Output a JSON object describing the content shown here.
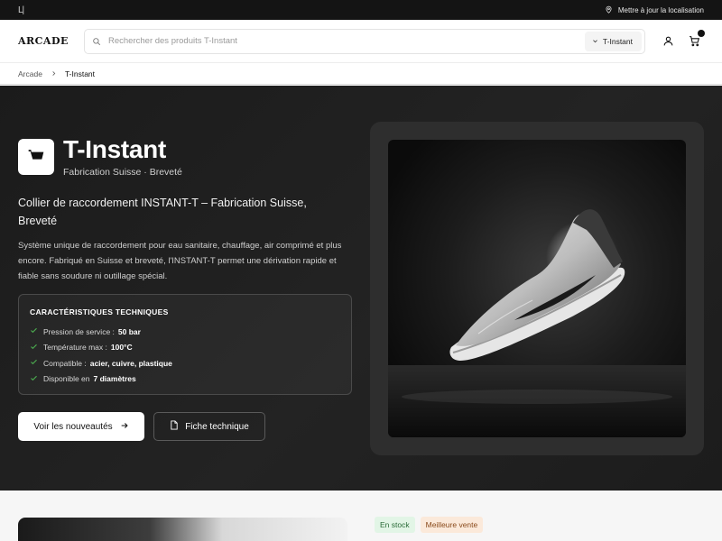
{
  "topbar": {
    "left_glyph": "L|",
    "location_label": "Mettre à jour la localisation"
  },
  "header": {
    "logo": "ARCADE",
    "search_placeholder": "Rechercher des produits T-Instant",
    "category_selected": "T-Instant",
    "cart_count": ""
  },
  "breadcrumb": {
    "items": [
      "Arcade",
      "T-Instant"
    ]
  },
  "hero": {
    "brand_title": "T-Instant",
    "brand_subtitle": "Fabrication Suisse · Breveté",
    "headline": "Collier de raccordement INSTANT-T – Fabrication Suisse, Breveté",
    "description": "Système unique de raccordement pour eau sanitaire, chauffage, air comprimé et plus encore. Fabriqué en Suisse et breveté, l'INSTANT-T permet une dérivation rapide et fiable sans soudure ni outillage spécial.",
    "specs_title": "CARACTÉRISTIQUES TECHNIQUES",
    "specs": [
      {
        "label": "Pression de service :",
        "value": "50 bar"
      },
      {
        "label": "Température max :",
        "value": "100°C"
      },
      {
        "label": "Compatible :",
        "value": "acier, cuivre, plastique"
      },
      {
        "label": "Disponible en",
        "value": "7 diamètres"
      }
    ],
    "primary_button": "Voir les nouveautés",
    "secondary_button": "Fiche technique"
  },
  "product": {
    "badges": [
      "En stock",
      "Meilleure vente"
    ]
  },
  "colors": {
    "hero_bg": "#1f1f1f",
    "accent_check": "#4caf50",
    "stock_badge": "#e2f5e6",
    "best_badge": "#fbe9da"
  },
  "icons": {
    "location": "map-pin-icon",
    "search": "search-icon",
    "chevron": "chevron-down-icon",
    "user": "user-icon",
    "cart": "cart-icon",
    "brand": "shopping-basket-icon",
    "check": "check-icon",
    "arrow": "arrow-right-icon",
    "document": "document-icon"
  }
}
